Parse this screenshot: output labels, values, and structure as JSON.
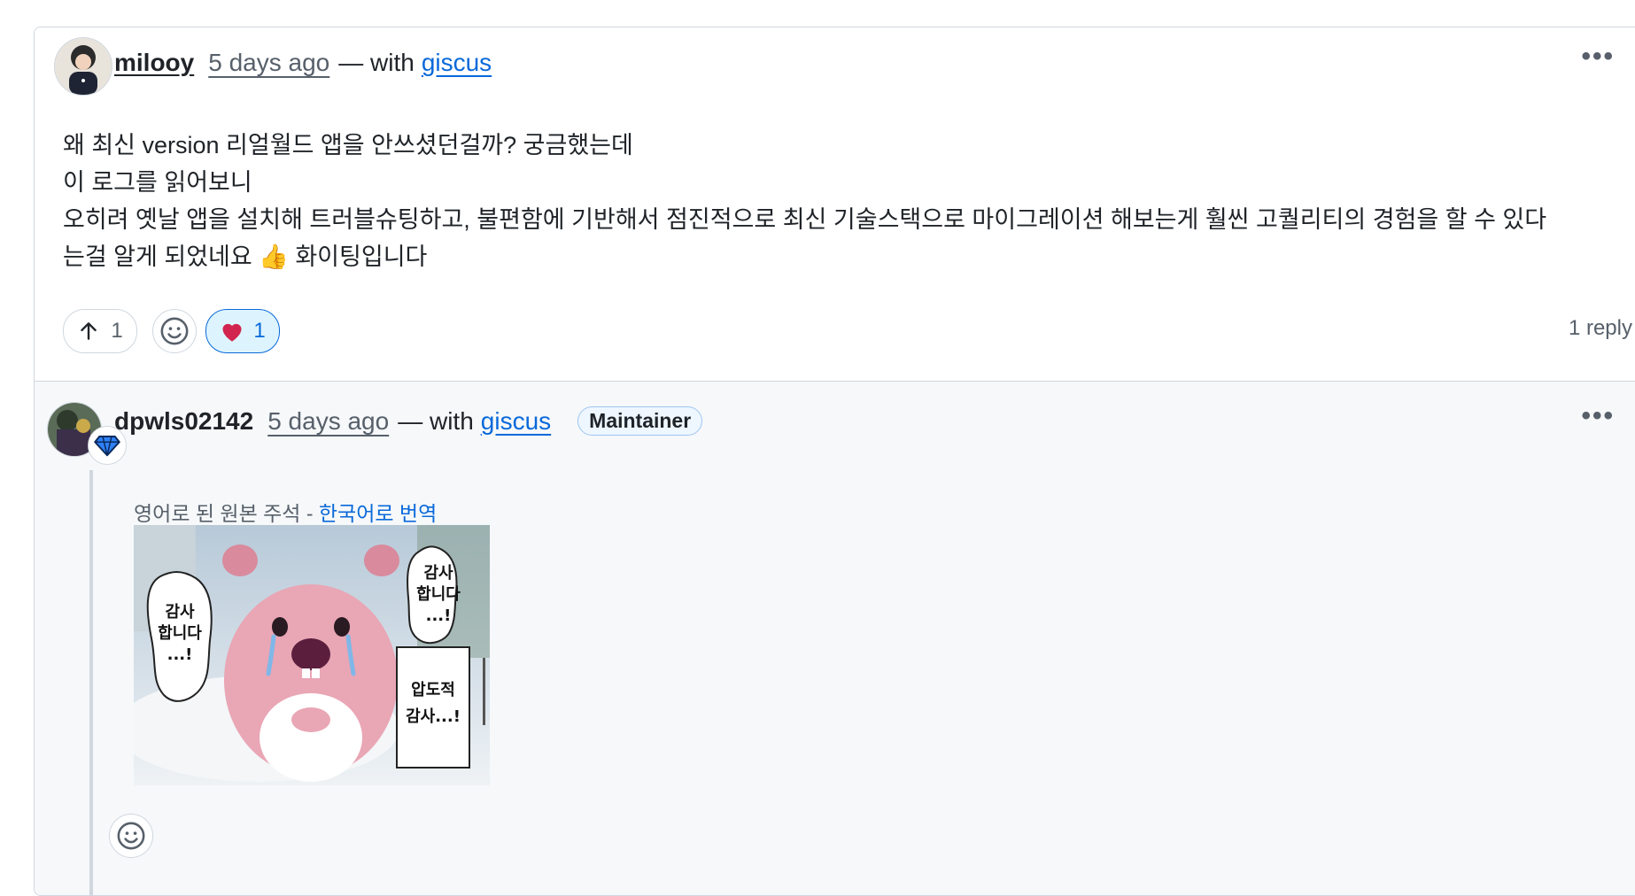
{
  "comment": {
    "author": "milooy",
    "time": "5 days ago",
    "with_text": "— with",
    "app_link": "giscus",
    "more_label": "•••",
    "body_lines": [
      "왜 최신 version 리얼월드 앱을 안쓰셨던걸까? 궁금했는데",
      "이 로그를 읽어보니",
      "오히려 옛날 앱을 설치해 트러블슈팅하고, 불편함에 기반해서 점진적으로 최신 기술스택으로 마이그레이션 해보는게 훨씬 고퀄리티의 경험을 할 수 있다",
      "는걸 알게 되었네요 👍 화이팅입니다"
    ],
    "upvote_count": "1",
    "heart_count": "1",
    "reply_count": "1 reply"
  },
  "reply": {
    "author": "dpwls02142",
    "time": "5 days ago",
    "with_text": "— with",
    "app_link": "giscus",
    "badge": "Maintainer",
    "more_label": "•••",
    "translate_prefix": "영어로 된 원본 주석 - ",
    "translate_link": "한국어로 번역",
    "image": {
      "bubble_left": [
        "감사",
        "합니다",
        "...!"
      ],
      "bubble_right": [
        "감사",
        "합니다",
        "...!"
      ],
      "box_text": [
        "압도적",
        "감사...!"
      ]
    }
  },
  "icons": {
    "upvote": "arrow-up-icon",
    "emoji": "smiley-icon",
    "heart": "heart-icon",
    "sponsor": "diamond-icon"
  },
  "colors": {
    "link": "#0969da",
    "muted": "#57606a",
    "border": "#d0d7de",
    "heart": "#d1244f"
  }
}
